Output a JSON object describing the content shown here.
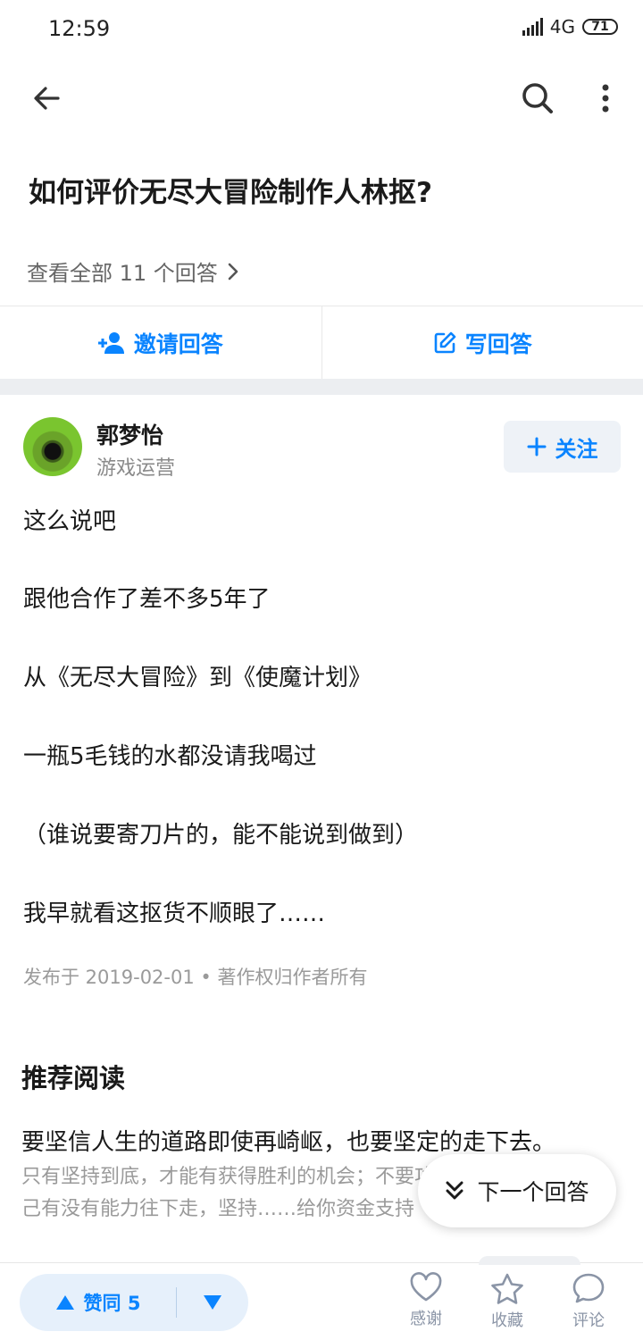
{
  "status_bar": {
    "time": "12:59",
    "network": "4G",
    "battery": "71"
  },
  "question": {
    "title": "如何评价无尽大冒险制作人林抠?",
    "view_all": "查看全部 11 个回答"
  },
  "actions": {
    "invite": "邀请回答",
    "write": "写回答"
  },
  "answer": {
    "author_name": "郭梦怡",
    "author_title": "游戏运营",
    "follow": "关注",
    "paragraphs": [
      "这么说吧",
      "跟他合作了差不多5年了",
      "从《无尽大冒险》到《使魔计划》",
      "一瓶5毛钱的水都没请我喝过",
      "（谁说要寄刀片的，能不能说到做到）",
      "我早就看这抠货不顺眼了……"
    ],
    "meta": "发布于 2019-02-01 • 著作权归作者所有"
  },
  "recommended": {
    "heading": "推荐阅读",
    "title": "要坚信人生的道路即使再崎岖，也要坚定的走下去。",
    "excerpt": "只有坚持到底，才能有获得胜利的机会；不要功亏一篑。不要怀疑自己有没有能力往下走，坚持……给你资金支持"
  },
  "next_answer": "下一个回答",
  "bottom_bar": {
    "upvote": "赞同 5",
    "thanks": "感谢",
    "favorite": "收藏",
    "comment": "评论"
  },
  "colors": {
    "accent": "#0a84ff",
    "vote_bg": "#e6f0fb",
    "divider": "#eceef1"
  }
}
